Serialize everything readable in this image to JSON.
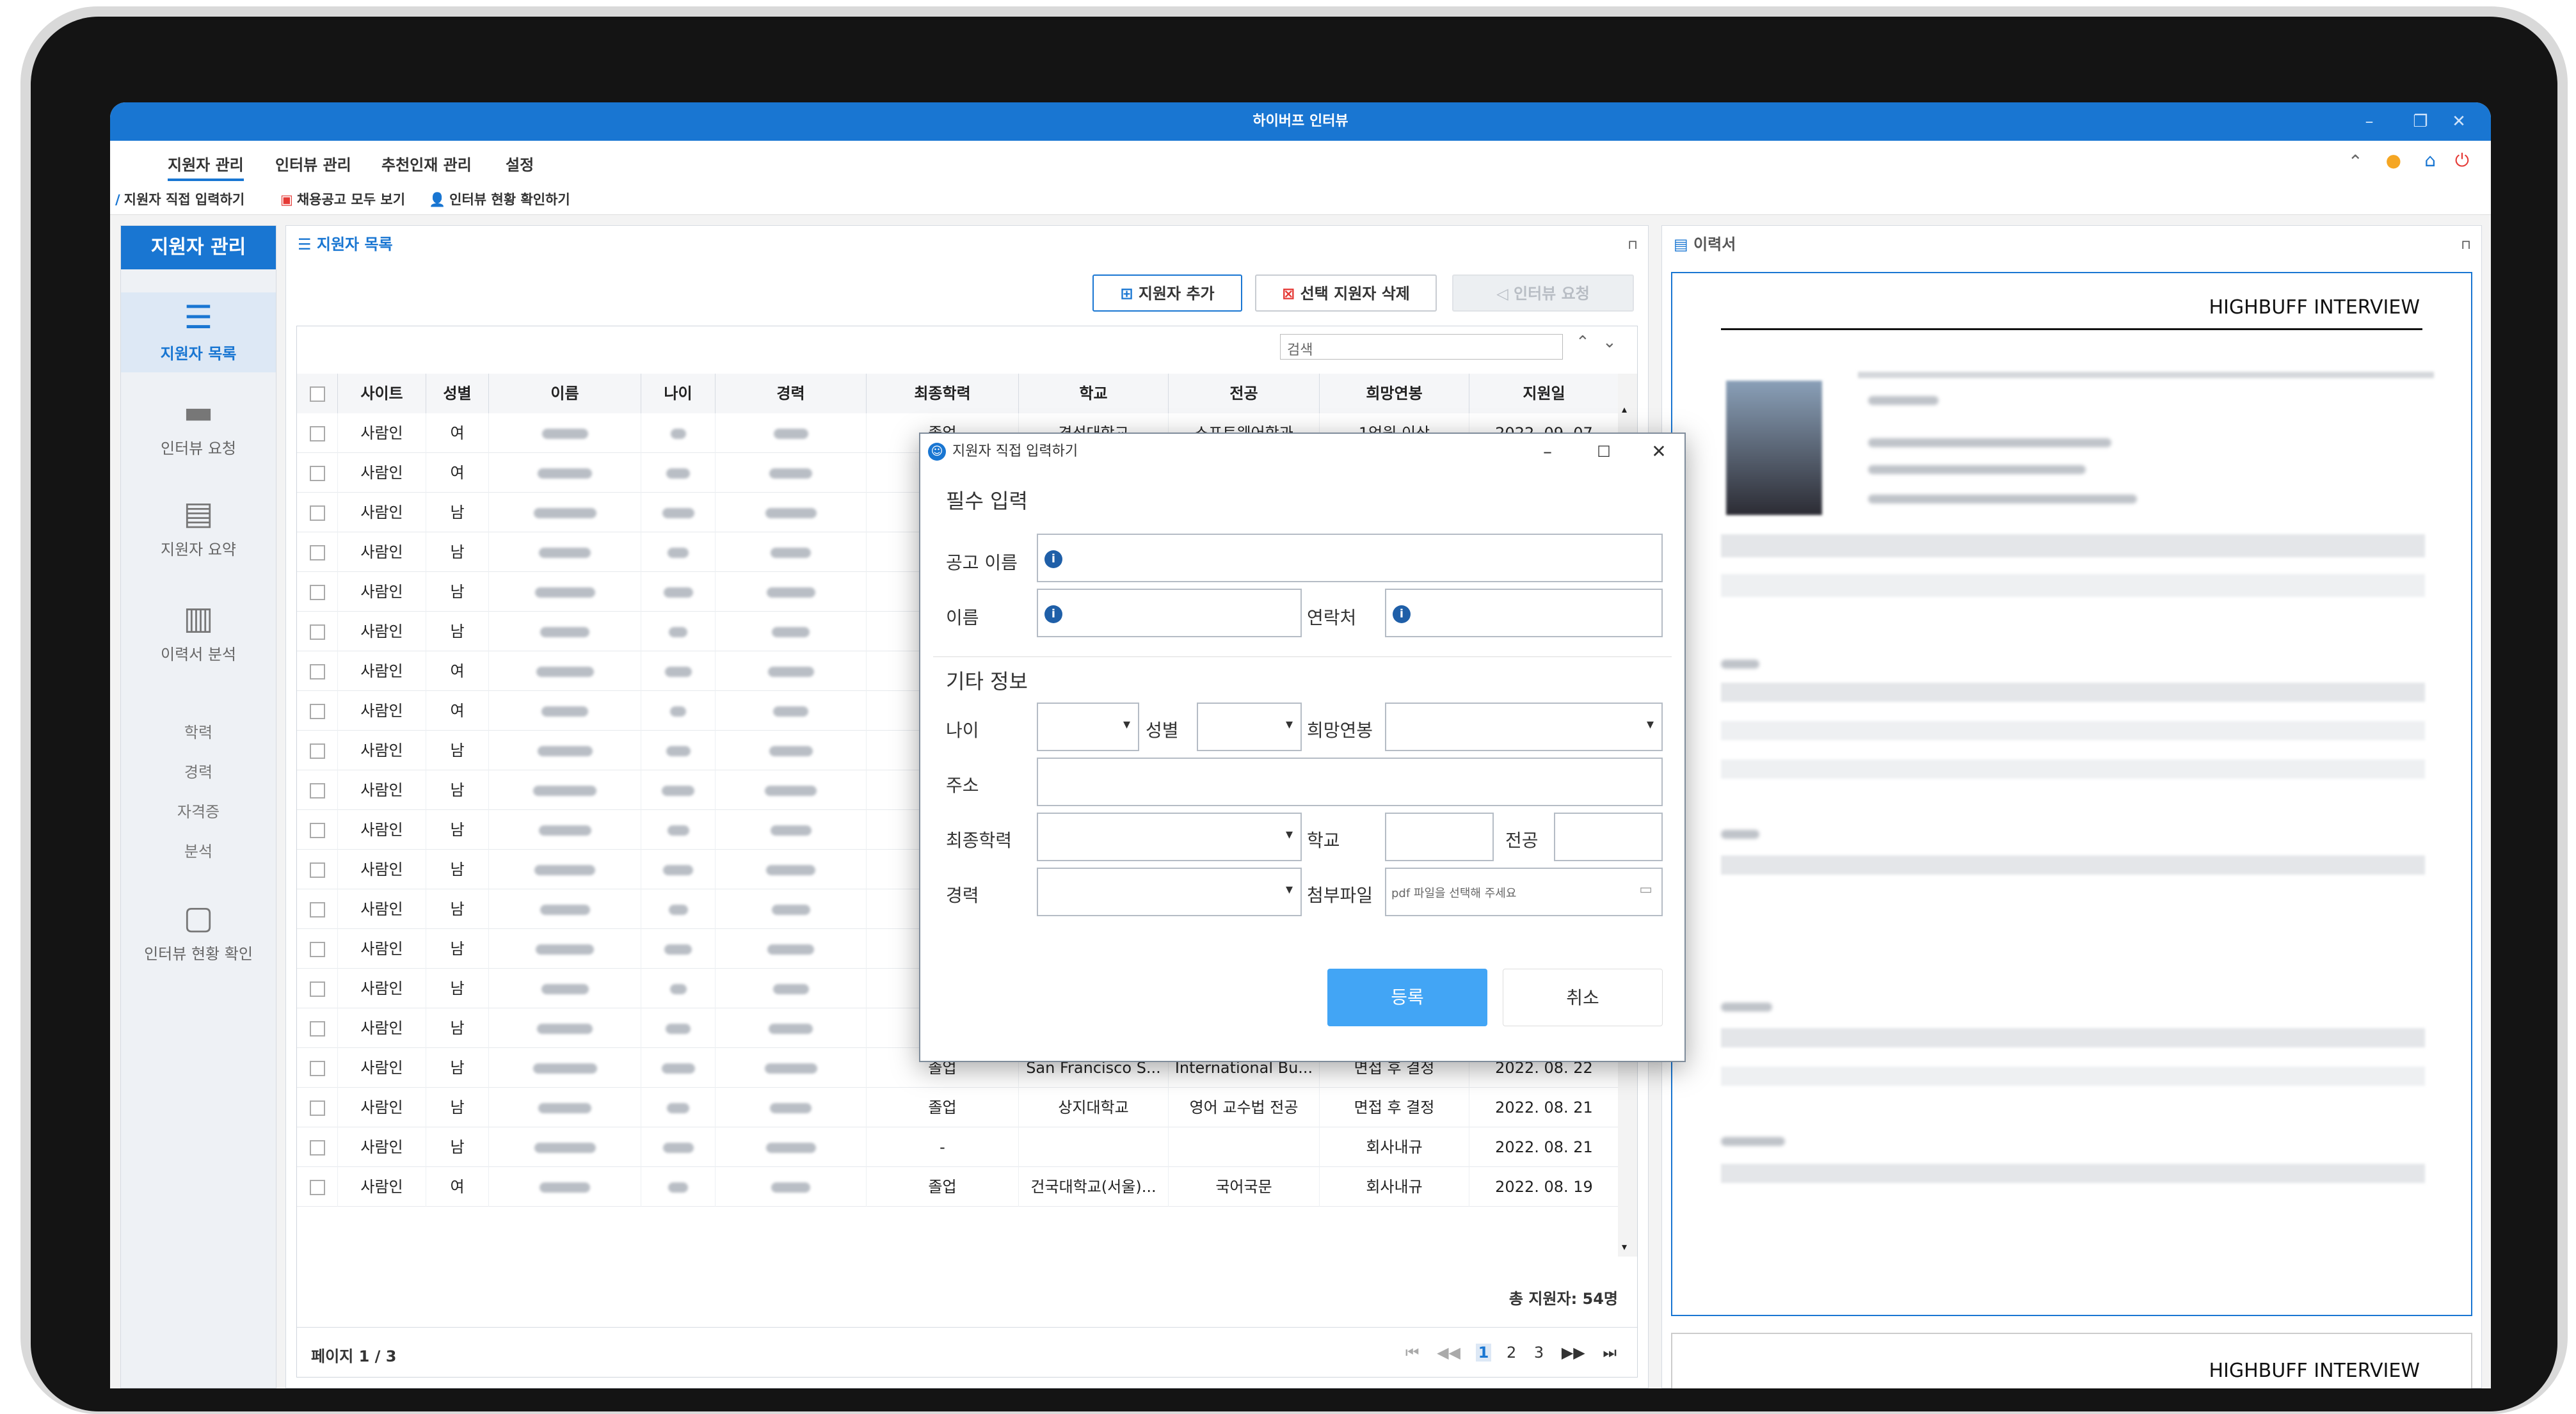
{
  "app": {
    "title": "하이버프 인터뷰",
    "window_controls": [
      "–",
      "❐",
      "✕"
    ]
  },
  "menus": [
    {
      "label": "지원자 관리",
      "active": true
    },
    {
      "label": "인터뷰 관리"
    },
    {
      "label": "추천인재 관리"
    },
    {
      "label": "설정"
    }
  ],
  "toolbar": [
    {
      "icon": "pencil-icon",
      "label": "지원자 직접 입력하기"
    },
    {
      "icon": "job-posting-icon",
      "label": "채용공고 모두 보기"
    },
    {
      "icon": "person-icon",
      "label": "인터뷰 현황 확인하기"
    }
  ],
  "sidebar": {
    "title": "지원자 관리",
    "items": [
      {
        "label": "지원자 목록",
        "icon": "list-icon",
        "active": true
      },
      {
        "label": "인터뷰 요청",
        "icon": "folder-icon"
      },
      {
        "label": "지원자 요약",
        "icon": "document-icon"
      },
      {
        "label": "이력서 분석",
        "icon": "bar-chart-icon"
      }
    ],
    "subitems": [
      "학력",
      "경력",
      "자격증",
      "분석"
    ],
    "last": {
      "label": "인터뷰 현황 확인",
      "icon": "person-card-icon"
    }
  },
  "list": {
    "title": "지원자 목록",
    "buttons": {
      "add": "지원자 추가",
      "delete": "선택 지원자 삭제",
      "interview": "인터뷰 요청"
    },
    "search_placeholder": "검색",
    "columns": [
      "사이트",
      "성별",
      "이름",
      "나이",
      "경력",
      "최종학력",
      "학교",
      "전공",
      "희망연봉",
      "지원일"
    ],
    "rows": [
      {
        "site": "사람인",
        "gender": "여",
        "edu": "졸업",
        "school": "경성대학교",
        "major": "소프트웨어학과",
        "salary": "1억원 이상",
        "date": "2022. 09. 07"
      },
      {
        "site": "사람인",
        "gender": "여"
      },
      {
        "site": "사람인",
        "gender": "남"
      },
      {
        "site": "사람인",
        "gender": "남"
      },
      {
        "site": "사람인",
        "gender": "남"
      },
      {
        "site": "사람인",
        "gender": "남"
      },
      {
        "site": "사람인",
        "gender": "여"
      },
      {
        "site": "사람인",
        "gender": "여"
      },
      {
        "site": "사람인",
        "gender": "남"
      },
      {
        "site": "사람인",
        "gender": "남"
      },
      {
        "site": "사람인",
        "gender": "남"
      },
      {
        "site": "사람인",
        "gender": "남"
      },
      {
        "site": "사람인",
        "gender": "남"
      },
      {
        "site": "사람인",
        "gender": "남"
      },
      {
        "site": "사람인",
        "gender": "남"
      },
      {
        "site": "사람인",
        "gender": "남"
      },
      {
        "site": "사람인",
        "gender": "남",
        "edu": "졸업",
        "school": "San Francisco S...",
        "major": "International Bu...",
        "salary": "면접 후 결정",
        "date": "2022. 08. 22"
      },
      {
        "site": "사람인",
        "gender": "남",
        "edu": "졸업",
        "school": "상지대학교",
        "major": "영어 교수법 전공",
        "salary": "면접 후 결정",
        "date": "2022. 08. 21"
      },
      {
        "site": "사람인",
        "gender": "남",
        "edu": "-",
        "school": "",
        "major": "",
        "salary": "회사내규",
        "date": "2022. 08. 21"
      },
      {
        "site": "사람인",
        "gender": "여",
        "edu": "졸업",
        "school": "건국대학교(서울)...",
        "major": "국어국문",
        "salary": "회사내규",
        "date": "2022. 08. 19"
      }
    ],
    "total": "총 지원자: 54명",
    "page_label": "페이지 1 / 3",
    "pages": [
      "1",
      "2",
      "3"
    ],
    "current_page": "1",
    "pager_icons": [
      "⏮",
      "◀◀",
      "▶▶",
      "⏭"
    ]
  },
  "resume": {
    "title": "이력서",
    "header": "HIGHBUFF INTERVIEW"
  },
  "modal": {
    "title": "지원자 직접 입력하기",
    "section_required": "필수 입력",
    "section_other": "기타 정보",
    "labels": {
      "posting": "공고 이름",
      "name": "이름",
      "contact": "연락처",
      "age": "나이",
      "gender": "성별",
      "salary": "희망연봉",
      "address": "주소",
      "edu": "최종학력",
      "school": "학교",
      "major": "전공",
      "career": "경력",
      "file": "첨부파일"
    },
    "file_placeholder": "pdf 파일을 선택해 주세요",
    "submit": "등록",
    "cancel": "취소"
  },
  "colors": {
    "accent": "#1976d2",
    "danger": "#e53935"
  }
}
